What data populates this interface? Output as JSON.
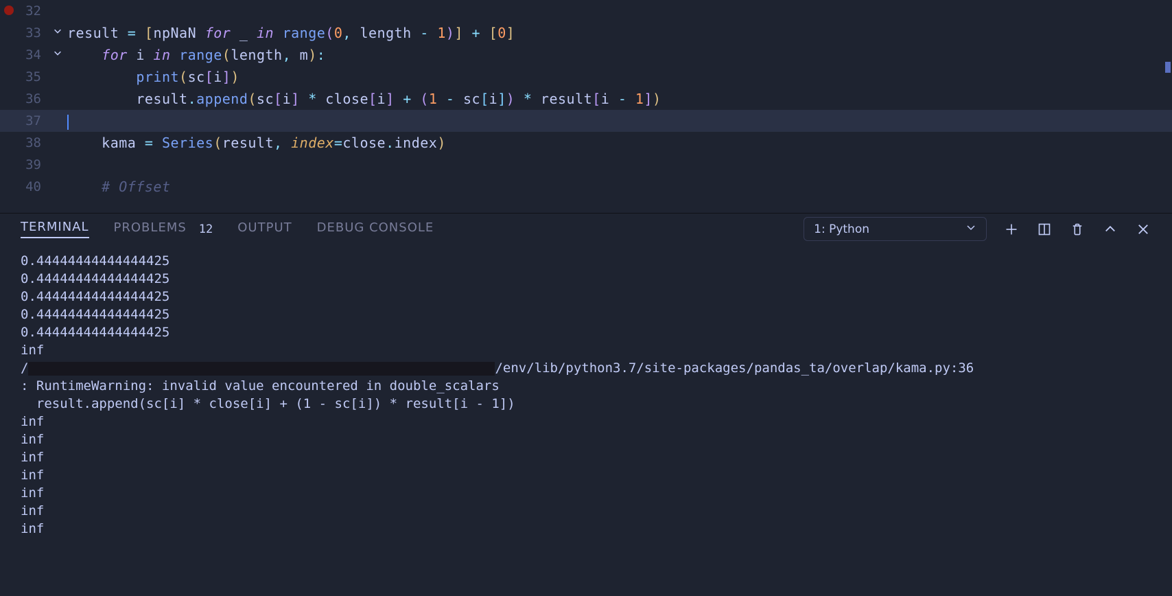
{
  "editor": {
    "lines": [
      {
        "num": "32",
        "chevron": "",
        "tokens": []
      },
      {
        "num": "33",
        "chevron": "v",
        "tokens": [
          {
            "t": "result ",
            "c": "var"
          },
          {
            "t": "=",
            "c": "op"
          },
          {
            "t": " ",
            "c": "var"
          },
          {
            "t": "[",
            "c": "paren-yellow"
          },
          {
            "t": "npNaN ",
            "c": "var"
          },
          {
            "t": "for",
            "c": "kw-purple"
          },
          {
            "t": " _ ",
            "c": "var"
          },
          {
            "t": "in",
            "c": "kw-purple"
          },
          {
            "t": " ",
            "c": "var"
          },
          {
            "t": "range",
            "c": "fn-blue"
          },
          {
            "t": "(",
            "c": "paren-purple"
          },
          {
            "t": "0",
            "c": "num"
          },
          {
            "t": ",",
            "c": "punct"
          },
          {
            "t": " length ",
            "c": "var"
          },
          {
            "t": "-",
            "c": "op"
          },
          {
            "t": " ",
            "c": "var"
          },
          {
            "t": "1",
            "c": "num"
          },
          {
            "t": ")",
            "c": "paren-purple"
          },
          {
            "t": "]",
            "c": "paren-yellow"
          },
          {
            "t": " ",
            "c": "var"
          },
          {
            "t": "+",
            "c": "op"
          },
          {
            "t": " ",
            "c": "var"
          },
          {
            "t": "[",
            "c": "paren-yellow"
          },
          {
            "t": "0",
            "c": "num"
          },
          {
            "t": "]",
            "c": "paren-yellow"
          }
        ]
      },
      {
        "num": "34",
        "chevron": "v",
        "tokens": [
          {
            "t": "    ",
            "c": "var"
          },
          {
            "t": "for",
            "c": "kw-purple"
          },
          {
            "t": " i ",
            "c": "var"
          },
          {
            "t": "in",
            "c": "kw-purple"
          },
          {
            "t": " ",
            "c": "var"
          },
          {
            "t": "range",
            "c": "fn-blue"
          },
          {
            "t": "(",
            "c": "paren-yellow"
          },
          {
            "t": "length",
            "c": "var"
          },
          {
            "t": ",",
            "c": "punct"
          },
          {
            "t": " m",
            "c": "var"
          },
          {
            "t": ")",
            "c": "paren-yellow"
          },
          {
            "t": ":",
            "c": "punct"
          }
        ]
      },
      {
        "num": "35",
        "chevron": "",
        "tokens": [
          {
            "t": "        ",
            "c": "var"
          },
          {
            "t": "print",
            "c": "fn-blue"
          },
          {
            "t": "(",
            "c": "paren-yellow"
          },
          {
            "t": "sc",
            "c": "var"
          },
          {
            "t": "[",
            "c": "paren-purple"
          },
          {
            "t": "i",
            "c": "var"
          },
          {
            "t": "]",
            "c": "paren-purple"
          },
          {
            "t": ")",
            "c": "paren-yellow"
          }
        ]
      },
      {
        "num": "36",
        "chevron": "",
        "tokens": [
          {
            "t": "        result",
            "c": "var"
          },
          {
            "t": ".",
            "c": "punct"
          },
          {
            "t": "append",
            "c": "fn-blue"
          },
          {
            "t": "(",
            "c": "paren-yellow"
          },
          {
            "t": "sc",
            "c": "var"
          },
          {
            "t": "[",
            "c": "paren-purple"
          },
          {
            "t": "i",
            "c": "var"
          },
          {
            "t": "]",
            "c": "paren-purple"
          },
          {
            "t": " ",
            "c": "var"
          },
          {
            "t": "*",
            "c": "op"
          },
          {
            "t": " close",
            "c": "var"
          },
          {
            "t": "[",
            "c": "paren-purple"
          },
          {
            "t": "i",
            "c": "var"
          },
          {
            "t": "]",
            "c": "paren-purple"
          },
          {
            "t": " ",
            "c": "var"
          },
          {
            "t": "+",
            "c": "op"
          },
          {
            "t": " ",
            "c": "var"
          },
          {
            "t": "(",
            "c": "paren-purple"
          },
          {
            "t": "1",
            "c": "num"
          },
          {
            "t": " ",
            "c": "var"
          },
          {
            "t": "-",
            "c": "op"
          },
          {
            "t": " sc",
            "c": "var"
          },
          {
            "t": "[",
            "c": "paren-blue"
          },
          {
            "t": "i",
            "c": "var"
          },
          {
            "t": "]",
            "c": "paren-blue"
          },
          {
            "t": ")",
            "c": "paren-purple"
          },
          {
            "t": " ",
            "c": "var"
          },
          {
            "t": "*",
            "c": "op"
          },
          {
            "t": " result",
            "c": "var"
          },
          {
            "t": "[",
            "c": "paren-purple"
          },
          {
            "t": "i ",
            "c": "var"
          },
          {
            "t": "-",
            "c": "op"
          },
          {
            "t": " ",
            "c": "var"
          },
          {
            "t": "1",
            "c": "num"
          },
          {
            "t": "]",
            "c": "paren-purple"
          },
          {
            "t": ")",
            "c": "paren-yellow"
          }
        ]
      },
      {
        "num": "37",
        "chevron": "",
        "highlighted": true,
        "cursor": true,
        "tokens": []
      },
      {
        "num": "38",
        "chevron": "",
        "tokens": [
          {
            "t": "    kama ",
            "c": "var"
          },
          {
            "t": "=",
            "c": "op"
          },
          {
            "t": " ",
            "c": "var"
          },
          {
            "t": "Series",
            "c": "fn-blue"
          },
          {
            "t": "(",
            "c": "paren-yellow"
          },
          {
            "t": "result",
            "c": "var"
          },
          {
            "t": ",",
            "c": "punct"
          },
          {
            "t": " ",
            "c": "var"
          },
          {
            "t": "index",
            "c": "param-orange"
          },
          {
            "t": "=",
            "c": "op"
          },
          {
            "t": "close",
            "c": "var"
          },
          {
            "t": ".",
            "c": "punct"
          },
          {
            "t": "index",
            "c": "var"
          },
          {
            "t": ")",
            "c": "paren-yellow"
          }
        ]
      },
      {
        "num": "39",
        "chevron": "",
        "tokens": []
      },
      {
        "num": "40",
        "chevron": "",
        "tokens": [
          {
            "t": "    ",
            "c": "var"
          },
          {
            "t": "# Offset",
            "c": "comment"
          }
        ]
      }
    ]
  },
  "panel": {
    "tabs": {
      "terminal": "TERMINAL",
      "problems": "PROBLEMS",
      "problems_count": "12",
      "output": "OUTPUT",
      "debug": "DEBUG CONSOLE"
    },
    "terminal_selector": "1: Python"
  },
  "terminal": {
    "lines": [
      "0.44444444444444425",
      "0.44444444444444425",
      "0.44444444444444425",
      "0.44444444444444425",
      "0.44444444444444425",
      "inf"
    ],
    "path_suffix": "/env/lib/python3.7/site-packages/pandas_ta/overlap/kama.py:36",
    "warning_line": ": RuntimeWarning: invalid value encountered in double_scalars",
    "code_line": "  result.append(sc[i] * close[i] + (1 - sc[i]) * result[i - 1])",
    "inf_lines": [
      "inf",
      "inf",
      "inf",
      "inf",
      "inf",
      "inf",
      "inf"
    ]
  }
}
